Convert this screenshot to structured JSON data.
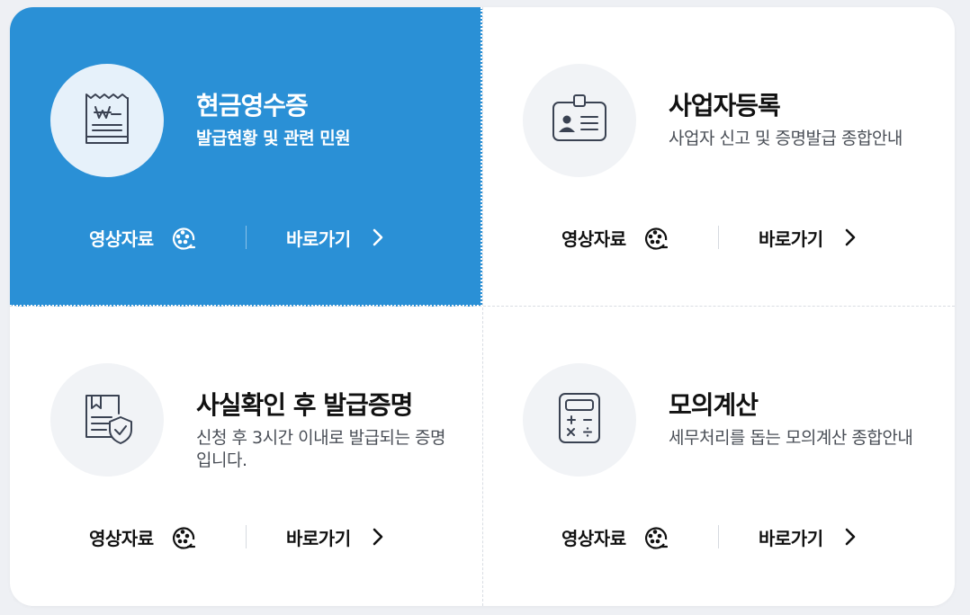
{
  "cards": [
    {
      "title": "현금영수증",
      "description": "발급현황 및 관련 민원",
      "icon": "receipt-won-icon",
      "active": true,
      "video_label": "영상자료",
      "go_label": "바로가기"
    },
    {
      "title": "사업자등록",
      "description": "사업자 신고 및 증명발급 종합안내",
      "icon": "id-card-icon",
      "active": false,
      "video_label": "영상자료",
      "go_label": "바로가기"
    },
    {
      "title": "사실확인 후 발급증명",
      "description": "신청 후 3시간 이내로 발급되는 증명입니다.",
      "icon": "certified-document-icon",
      "active": false,
      "video_label": "영상자료",
      "go_label": "바로가기"
    },
    {
      "title": "모의계산",
      "description": "세무처리를 돕는 모의계산 종합안내",
      "icon": "calculator-icon",
      "active": false,
      "video_label": "영상자료",
      "go_label": "바로가기"
    }
  ],
  "colors": {
    "accent": "#2a90d6",
    "text": "#111111",
    "muted": "#4a4f57",
    "icon_stroke": "#3a4252"
  }
}
